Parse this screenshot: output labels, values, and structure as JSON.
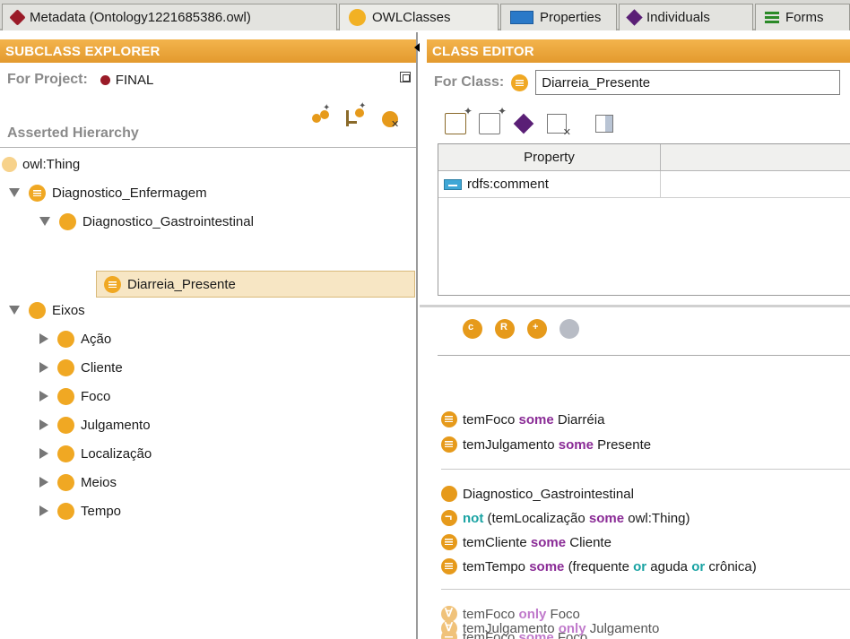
{
  "tabs": [
    {
      "label": "Metadata (Ontology1221685386.owl)",
      "icon": "metadata-diamond-icon"
    },
    {
      "label": "OWLClasses",
      "icon": "owl-classes-circle-icon"
    },
    {
      "label": "Properties",
      "icon": "properties-rect-icon"
    },
    {
      "label": "Individuals",
      "icon": "individuals-diamond-icon"
    },
    {
      "label": "Forms",
      "icon": "forms-icon"
    }
  ],
  "left": {
    "header": "SUBCLASS EXPLORER",
    "project_label": "For Project:",
    "project_name": "FINAL",
    "hierarchy_label": "Asserted Hierarchy",
    "tree": [
      {
        "label": "owl:Thing",
        "level": 0,
        "expander": "none",
        "icon": "pale"
      },
      {
        "label": "Diagnostico_Enfermagem",
        "level": 0,
        "expander": "open",
        "icon": "defined"
      },
      {
        "label": "Diagnostico_Gastrointestinal",
        "level": 1,
        "expander": "open",
        "icon": "class"
      },
      {
        "label": "Diarreia_Presente",
        "level": 2,
        "expander": "none",
        "icon": "defined",
        "selected": true
      },
      {
        "label": "Eixos",
        "level": 0,
        "expander": "open",
        "icon": "class"
      },
      {
        "label": "Ação",
        "level": 1,
        "expander": "closed",
        "icon": "class"
      },
      {
        "label": "Cliente",
        "level": 1,
        "expander": "closed",
        "icon": "class"
      },
      {
        "label": "Foco",
        "level": 1,
        "expander": "closed",
        "icon": "class"
      },
      {
        "label": "Julgamento",
        "level": 1,
        "expander": "closed",
        "icon": "class"
      },
      {
        "label": "Localização",
        "level": 1,
        "expander": "closed",
        "icon": "class"
      },
      {
        "label": "Meios",
        "level": 1,
        "expander": "closed",
        "icon": "class"
      },
      {
        "label": "Tempo",
        "level": 1,
        "expander": "closed",
        "icon": "class"
      }
    ]
  },
  "right": {
    "header": "CLASS EDITOR",
    "for_class_label": "For Class:",
    "class_name": "Diarreia_Presente",
    "property_col_header": "Property",
    "properties": [
      "rdfs:comment"
    ],
    "conditions": {
      "group1": [
        {
          "icon": "restriction",
          "prop": "temFoco",
          "kw": "some",
          "filler": "Diarréia"
        },
        {
          "icon": "restriction",
          "prop": "temJulgamento",
          "kw": "some",
          "filler": "Presente"
        }
      ],
      "group2": [
        {
          "icon": "class",
          "text": "Diagnostico_Gastrointestinal"
        },
        {
          "icon": "not",
          "kw_not": "not",
          "pre": "(temLocalização",
          "kw": "some",
          "post": "owl:Thing)"
        },
        {
          "icon": "restriction",
          "prop": "temCliente",
          "kw": "some",
          "filler": "Cliente"
        },
        {
          "icon": "restriction",
          "prop": "temTempo",
          "kw": "some",
          "open": "(frequente",
          "or1": "or",
          "mid": "aguda",
          "or2": "or",
          "close": "crônica)"
        }
      ],
      "group3": [
        {
          "icon": "forall",
          "prop": "temFoco",
          "kw": "only",
          "filler": "Foco"
        },
        {
          "icon": "restriction-faded",
          "prop": "temFoco",
          "kw": "some",
          "filler": "Foco"
        },
        {
          "icon": "forall",
          "prop": "temJulgamento",
          "kw": "only",
          "filler": "Julgamento"
        }
      ]
    }
  },
  "colors": {
    "header_orange": "#e9a33a",
    "class_orange": "#f0a823",
    "keyword_purple": "#8a2b96",
    "keyword_teal": "#1aa3a3",
    "project_red": "#9a1b28"
  }
}
